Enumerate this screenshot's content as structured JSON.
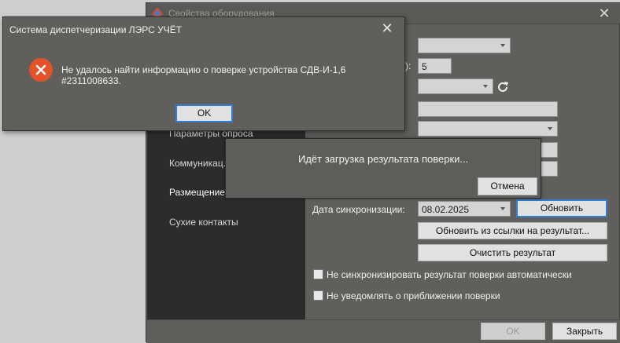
{
  "main_window": {
    "title": "Свойства оборудования",
    "partial_label": "):",
    "interval_value": "5",
    "sidebar": {
      "items": [
        {
          "label": "Параметры опроса",
          "active": false
        },
        {
          "label": "Коммуникац. с",
          "active": false
        },
        {
          "label": "Размещение",
          "active": true
        },
        {
          "label": "Сухие контакты",
          "active": false
        }
      ]
    },
    "sync_label": "Дата синхронизации:",
    "sync_date": "08.02.2025",
    "update_button": "Обновить",
    "update_from_link_button": "Обновить из ссылки на результат...",
    "clear_result_button": "Очистить результат",
    "checkbox_no_auto_sync": {
      "label": "Не синхронизировать результат поверки автоматически",
      "checked": false
    },
    "checkbox_no_notify": {
      "label": "Не уведомлять о приближении поверки",
      "checked": false
    },
    "ok_button": "OK",
    "close_button": "Закрыть"
  },
  "loading_popup": {
    "text": "Идёт загрузка результата поверки...",
    "cancel_button": "Отмена"
  },
  "message_box": {
    "title": "Система диспетчеризации ЛЭРС УЧЁТ",
    "message": "Не удалось найти информацию о поверке устройства СДВ-И-1,6 #2311008633.",
    "ok_button": "OK",
    "icon": "error-icon"
  },
  "colors": {
    "window_bg": "#615f5c",
    "sidebar_bg": "#2c2c2c",
    "error_red": "#e4522a",
    "focus_blue": "#2f7ed8"
  }
}
